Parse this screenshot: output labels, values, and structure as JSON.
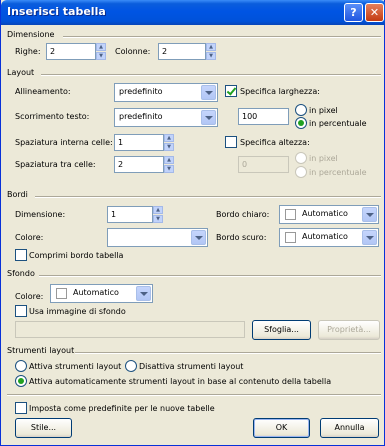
{
  "window": {
    "title": "Inserisci tabella"
  },
  "titlebar": {
    "help_glyph": "?",
    "close_glyph": "✕"
  },
  "dimensione": {
    "title": "Dimensione",
    "righe_label": "Righe:",
    "righe_value": "2",
    "colonne_label": "Colonne:",
    "colonne_value": "2"
  },
  "layout": {
    "title": "Layout",
    "allineamento_label": "Allineamento:",
    "allineamento_value": "predefinito",
    "scorrimento_label": "Scorrimento testo:",
    "scorrimento_value": "predefinito",
    "spaziatura_interna_label": "Spaziatura interna celle:",
    "spaziatura_interna_value": "1",
    "spaziatura_tra_label": "Spaziatura tra celle:",
    "spaziatura_tra_value": "2",
    "specifica_larghezza_label": "Specifica larghezza:",
    "specifica_larghezza_checked": true,
    "larghezza_value": "100",
    "in_pixel_label": "in pixel",
    "in_percentuale_label": "in percentuale",
    "specifica_altezza_label": "Specifica altezza:",
    "specifica_altezza_checked": false,
    "altezza_value": "0",
    "altezza_pixel_label": "in pixel",
    "altezza_percentuale_label": "in percentuale"
  },
  "bordi": {
    "title": "Bordi",
    "dimensione_label": "Dimensione:",
    "dimensione_value": "1",
    "colore_label": "Colore:",
    "colore_value": "",
    "comprimi_label": "Comprimi bordo tabella",
    "comprimi_checked": false,
    "bordo_chiaro_label": "Bordo chiaro:",
    "bordo_chiaro_value": "Automatico",
    "bordo_scuro_label": "Bordo scuro:",
    "bordo_scuro_value": "Automatico"
  },
  "sfondo": {
    "title": "Sfondo",
    "colore_label": "Colore:",
    "colore_value": "Automatico",
    "usa_immagine_label": "Usa immagine di sfondo",
    "usa_immagine_checked": false,
    "immagine_path": "",
    "sfoglia_label": "Sfoglia...",
    "proprieta_label": "Proprietà..."
  },
  "strumenti": {
    "title": "Strumenti layout",
    "attiva_label": "Attiva strumenti layout",
    "disattiva_label": "Disattiva strumenti layout",
    "auto_label": "Attiva automaticamente strumenti layout in base al contenuto della tabella",
    "selected": "auto"
  },
  "footer": {
    "imposta_label": "Imposta come predefinite per le nuove tabelle",
    "imposta_checked": false,
    "stile_label": "Stile...",
    "ok_label": "OK",
    "annulla_label": "Annulla"
  },
  "colors": {
    "title_bar": "#0054e3",
    "dialog_bg": "#ece9d8",
    "check_mark": "#21a121"
  }
}
